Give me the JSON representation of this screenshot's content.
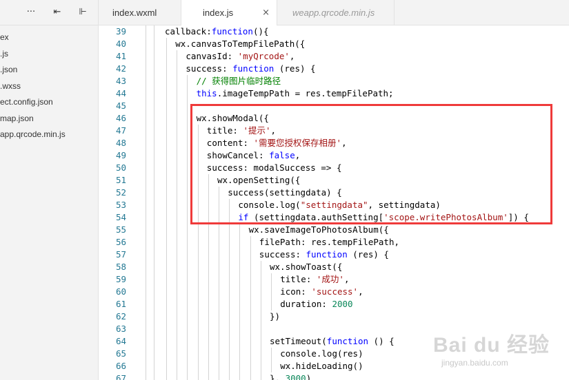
{
  "colors": {
    "keyword": "#0000ff",
    "string": "#a31515",
    "comment": "#008000",
    "plain": "#000000",
    "number": "#098658",
    "line_number": "#237893",
    "highlight_box": "#ef3a3a"
  },
  "sidebar": {
    "toolbar": [
      {
        "icon": "more-icon",
        "glyph": "···"
      },
      {
        "icon": "collapse-all-icon",
        "glyph": "⇤"
      },
      {
        "icon": "split-layout-icon",
        "glyph": "⊩"
      }
    ],
    "files": [
      {
        "label": "ex"
      },
      {
        "label": ".js"
      },
      {
        "label": ".json"
      },
      {
        "label": ".wxss"
      },
      {
        "label": "ect.config.json"
      },
      {
        "label": "map.json"
      },
      {
        "label": "app.qrcode.min.js"
      }
    ]
  },
  "tabs": [
    {
      "label": "index.wxml"
    },
    {
      "label": "index.js",
      "close": "×"
    },
    {
      "label": "weapp.qrcode.min.js"
    }
  ],
  "editor": {
    "lines": [
      {
        "n": "39",
        "indent": 0,
        "tokens": [
          {
            "t": "callback:",
            "k": "plain"
          },
          {
            "t": "function",
            "k": "keyword"
          },
          {
            "t": "(){",
            "k": "plain"
          }
        ]
      },
      {
        "n": "40",
        "indent": 1,
        "tokens": [
          {
            "t": "wx.canvasToTempFilePath({",
            "k": "plain"
          }
        ]
      },
      {
        "n": "41",
        "indent": 2,
        "tokens": [
          {
            "t": "canvasId: ",
            "k": "plain"
          },
          {
            "t": "'myQrcode'",
            "k": "string"
          },
          {
            "t": ",",
            "k": "plain"
          }
        ]
      },
      {
        "n": "42",
        "indent": 2,
        "tokens": [
          {
            "t": "success: ",
            "k": "plain"
          },
          {
            "t": "function",
            "k": "keyword"
          },
          {
            "t": " (res) {",
            "k": "plain"
          }
        ]
      },
      {
        "n": "43",
        "indent": 3,
        "tokens": [
          {
            "t": "// 获得图片临时路径",
            "k": "comment"
          }
        ]
      },
      {
        "n": "44",
        "indent": 3,
        "tokens": [
          {
            "t": "this",
            "k": "keyword"
          },
          {
            "t": ".imageTempPath = res.tempFilePath;",
            "k": "plain"
          }
        ]
      },
      {
        "n": "45",
        "indent": 3,
        "tokens": []
      },
      {
        "n": "46",
        "indent": 3,
        "tokens": [
          {
            "t": "wx.showModal({",
            "k": "plain"
          }
        ]
      },
      {
        "n": "47",
        "indent": 4,
        "tokens": [
          {
            "t": "title: ",
            "k": "plain"
          },
          {
            "t": "'提示'",
            "k": "string"
          },
          {
            "t": ",",
            "k": "plain"
          }
        ]
      },
      {
        "n": "48",
        "indent": 4,
        "tokens": [
          {
            "t": "content: ",
            "k": "plain"
          },
          {
            "t": "'需要您授权保存相册'",
            "k": "string"
          },
          {
            "t": ",",
            "k": "plain"
          }
        ]
      },
      {
        "n": "49",
        "indent": 4,
        "tokens": [
          {
            "t": "showCancel: ",
            "k": "plain"
          },
          {
            "t": "false",
            "k": "keyword"
          },
          {
            "t": ",",
            "k": "plain"
          }
        ]
      },
      {
        "n": "50",
        "indent": 4,
        "tokens": [
          {
            "t": "success: modalSuccess => {",
            "k": "plain"
          }
        ]
      },
      {
        "n": "51",
        "indent": 5,
        "tokens": [
          {
            "t": "wx.openSetting({",
            "k": "plain"
          }
        ]
      },
      {
        "n": "52",
        "indent": 6,
        "tokens": [
          {
            "t": "success(settingdata) {",
            "k": "plain"
          }
        ]
      },
      {
        "n": "53",
        "indent": 7,
        "tokens": [
          {
            "t": "console.log(",
            "k": "plain"
          },
          {
            "t": "\"settingdata\"",
            "k": "string"
          },
          {
            "t": ", settingdata)",
            "k": "plain"
          }
        ]
      },
      {
        "n": "54",
        "indent": 7,
        "tokens": [
          {
            "t": "if",
            "k": "keyword"
          },
          {
            "t": " (settingdata.authSetting[",
            "k": "plain"
          },
          {
            "t": "'scope.writePhotosAlbum'",
            "k": "string"
          },
          {
            "t": "]) {",
            "k": "plain"
          }
        ]
      },
      {
        "n": "55",
        "indent": 8,
        "tokens": [
          {
            "t": "wx.saveImageToPhotosAlbum({",
            "k": "plain"
          }
        ]
      },
      {
        "n": "56",
        "indent": 9,
        "tokens": [
          {
            "t": "filePath: res.tempFilePath,",
            "k": "plain"
          }
        ]
      },
      {
        "n": "57",
        "indent": 9,
        "tokens": [
          {
            "t": "success: ",
            "k": "plain"
          },
          {
            "t": "function",
            "k": "keyword"
          },
          {
            "t": " (res) {",
            "k": "plain"
          }
        ]
      },
      {
        "n": "58",
        "indent": 10,
        "tokens": [
          {
            "t": "wx.showToast({",
            "k": "plain"
          }
        ]
      },
      {
        "n": "59",
        "indent": 11,
        "tokens": [
          {
            "t": "title: ",
            "k": "plain"
          },
          {
            "t": "'成功'",
            "k": "string"
          },
          {
            "t": ",",
            "k": "plain"
          }
        ]
      },
      {
        "n": "60",
        "indent": 11,
        "tokens": [
          {
            "t": "icon: ",
            "k": "plain"
          },
          {
            "t": "'success'",
            "k": "string"
          },
          {
            "t": ",",
            "k": "plain"
          }
        ]
      },
      {
        "n": "61",
        "indent": 11,
        "tokens": [
          {
            "t": "duration: ",
            "k": "plain"
          },
          {
            "t": "2000",
            "k": "number"
          }
        ]
      },
      {
        "n": "62",
        "indent": 10,
        "tokens": [
          {
            "t": "})",
            "k": "plain"
          }
        ]
      },
      {
        "n": "63",
        "indent": 10,
        "tokens": []
      },
      {
        "n": "64",
        "indent": 10,
        "tokens": [
          {
            "t": "setTimeout(",
            "k": "plain"
          },
          {
            "t": "function",
            "k": "keyword"
          },
          {
            "t": " () {",
            "k": "plain"
          }
        ]
      },
      {
        "n": "65",
        "indent": 11,
        "tokens": [
          {
            "t": "console.log(res)",
            "k": "plain"
          }
        ]
      },
      {
        "n": "66",
        "indent": 11,
        "tokens": [
          {
            "t": "wx.hideLoading()",
            "k": "plain"
          }
        ]
      },
      {
        "n": "67",
        "indent": 10,
        "tokens": [
          {
            "t": "}, ",
            "k": "plain"
          },
          {
            "t": "3000",
            "k": "number"
          },
          {
            "t": ")",
            "k": "plain"
          }
        ]
      }
    ]
  },
  "watermark": {
    "logo": "Bai du 经验",
    "url": "jingyan.baidu.com"
  }
}
